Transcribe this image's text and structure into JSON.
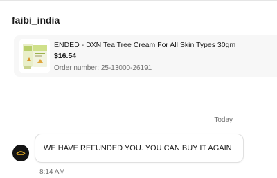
{
  "conversation": {
    "seller_name": "faibi_india"
  },
  "order_card": {
    "title": "ENDED - DXN Tea Tree Cream For All Skin Types 30gm",
    "price": "$16.54",
    "order_label": "Order number: ",
    "order_number": "25-13000-26191",
    "thumbnail_icon": "product-image"
  },
  "messages": {
    "day_label": "Today",
    "items": [
      {
        "text": "WE HAVE REFUNDED YOU. YOU CAN BUY IT AGAIN",
        "time": "8:14 AM",
        "avatar_icon": "seller-avatar"
      }
    ]
  },
  "colors": {
    "text_primary": "#191919",
    "text_secondary": "#707070",
    "card_background": "#f7f7f7",
    "bubble_border": "#e0e0e0"
  }
}
